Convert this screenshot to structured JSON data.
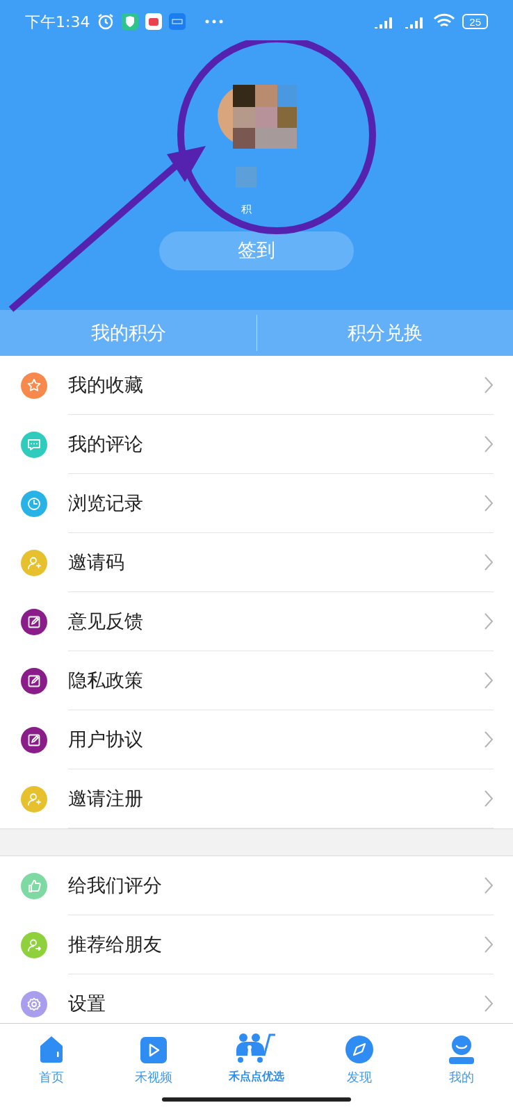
{
  "status_bar": {
    "time": "下午1:34",
    "battery": "25"
  },
  "profile": {
    "points_label": "积"
  },
  "checkin_button": "签到",
  "points_tabs": [
    "我的积分",
    "积分兑换"
  ],
  "menu_groups": [
    [
      {
        "label": "我的收藏",
        "kind": "star",
        "color": "#f7894c"
      },
      {
        "label": "我的评论",
        "kind": "comment",
        "color": "#2fcbbd"
      },
      {
        "label": "浏览记录",
        "kind": "clock",
        "color": "#27b3e6"
      },
      {
        "label": "邀请码",
        "kind": "user-plus",
        "color": "#e6c02d"
      },
      {
        "label": "意见反馈",
        "kind": "edit",
        "color": "#8b1d8b"
      },
      {
        "label": "隐私政策",
        "kind": "edit",
        "color": "#8b1d8b"
      },
      {
        "label": "用户协议",
        "kind": "edit",
        "color": "#8b1d8b"
      },
      {
        "label": "邀请注册",
        "kind": "user-plus",
        "color": "#e6c02d"
      }
    ],
    [
      {
        "label": "给我们评分",
        "kind": "thumb",
        "color": "#7fd9a3"
      },
      {
        "label": "推荐给朋友",
        "kind": "user-share",
        "color": "#8fd13d"
      },
      {
        "label": "设置",
        "kind": "gear",
        "color": "#a99ded"
      }
    ]
  ],
  "bottom_nav": [
    {
      "label": "首页",
      "kind": "home"
    },
    {
      "label": "禾视频",
      "kind": "video"
    },
    {
      "label": "禾点点优选",
      "kind": "cart"
    },
    {
      "label": "发现",
      "kind": "compass"
    },
    {
      "label": "我的",
      "kind": "user"
    }
  ]
}
